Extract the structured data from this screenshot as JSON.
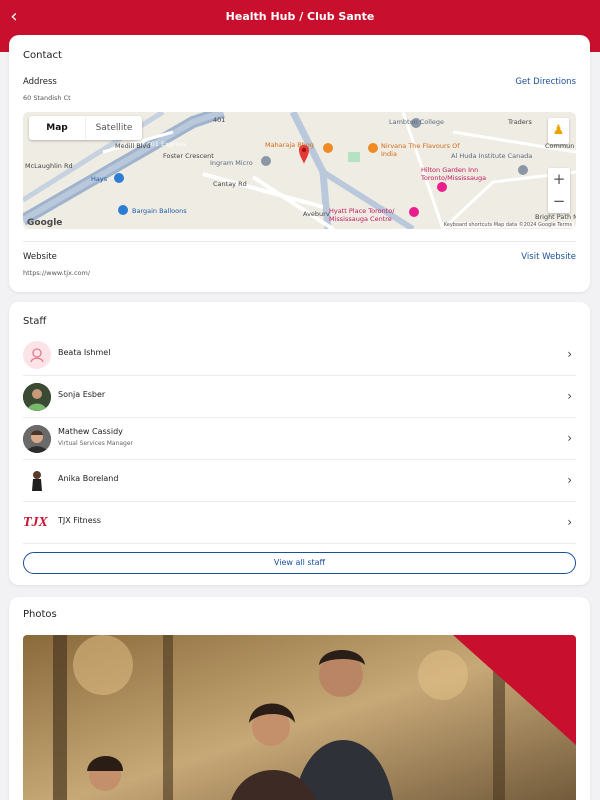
{
  "header": {
    "title": "Health Hub / Club Sante",
    "back_icon": "chevron-left-icon"
  },
  "contact": {
    "heading": "Contact",
    "address_label": "Address",
    "address_value": "60 Standish Ct",
    "directions_link": "Get Directions",
    "map": {
      "type_map": "Map",
      "type_satellite": "Satellite",
      "attribution": "Keyboard shortcuts   Map data ©2024 Google   Terms",
      "google_logo": "Google",
      "places": [
        "Lambton College",
        "Nirvana The Flavours Of India",
        "Maharaja Bhog",
        "Ingram Micro",
        "Hilton Garden Inn Toronto/Mississauga",
        "Al Huda Institute Canada",
        "Hyatt Place Toronto/ Mississauga Centre",
        "Bargain Balloons",
        "Hays",
        "Cantay Rd",
        "Aveburv",
        "Foster Crescent",
        "CN 401 Express",
        "McLaughlin Rd",
        "401",
        "Bright Path M",
        "Commun",
        "Traders",
        "Medill Blvd"
      ]
    },
    "website_label": "Website",
    "website_value": "https://www.tjx.com/",
    "website_link": "Visit Website"
  },
  "staff": {
    "heading": "Staff",
    "members": [
      {
        "name": "Beata Ishmel",
        "role": ""
      },
      {
        "name": "Sonja Esber",
        "role": ""
      },
      {
        "name": "Mathew Cassidy",
        "role": "Virtual Services Manager"
      },
      {
        "name": "Anika Boreland",
        "role": ""
      },
      {
        "name": "TJX Fitness",
        "role": ""
      }
    ],
    "view_all": "View all staff",
    "tjx_logo": "TJX"
  },
  "photos": {
    "heading": "Photos"
  },
  "colors": {
    "brand_red": "#c8102e",
    "link_blue": "#1b4f9c"
  }
}
